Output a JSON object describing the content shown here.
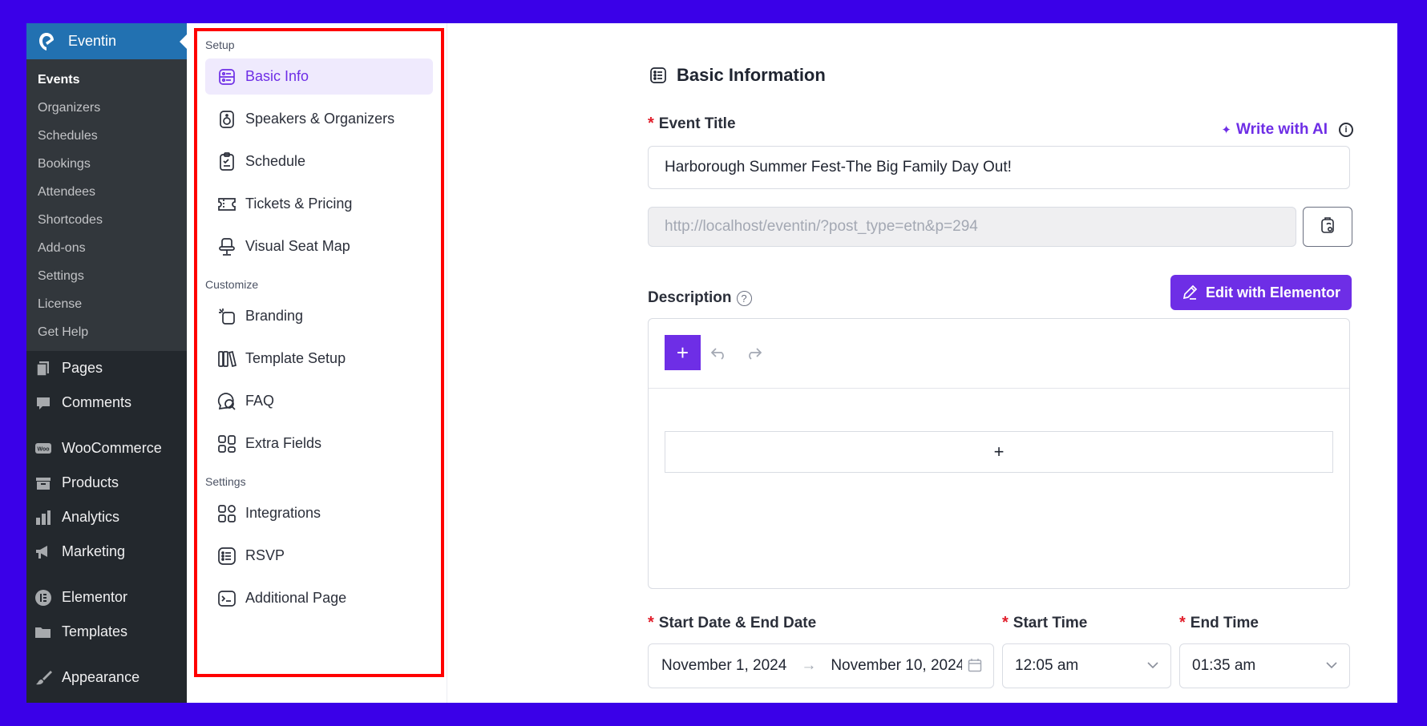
{
  "wp_sidebar": {
    "brand": "Eventin",
    "submenu": [
      "Events",
      "Organizers",
      "Schedules",
      "Bookings",
      "Attendees",
      "Shortcodes",
      "Add-ons",
      "Settings",
      "License",
      "Get Help"
    ],
    "menu": [
      {
        "label": "Pages",
        "icon": "pages-icon"
      },
      {
        "label": "Comments",
        "icon": "comments-icon"
      },
      {
        "label": "WooCommerce",
        "icon": "woocommerce-icon"
      },
      {
        "label": "Products",
        "icon": "products-icon"
      },
      {
        "label": "Analytics",
        "icon": "analytics-icon"
      },
      {
        "label": "Marketing",
        "icon": "marketing-icon"
      },
      {
        "label": "Elementor",
        "icon": "elementor-icon"
      },
      {
        "label": "Templates",
        "icon": "templates-icon"
      },
      {
        "label": "Appearance",
        "icon": "appearance-icon"
      }
    ]
  },
  "event_nav": {
    "sections": [
      {
        "title": "Setup",
        "items": [
          "Basic Info",
          "Speakers & Organizers",
          "Schedule",
          "Tickets & Pricing",
          "Visual Seat Map"
        ]
      },
      {
        "title": "Customize",
        "items": [
          "Branding",
          "Template Setup",
          "FAQ",
          "Extra Fields"
        ]
      },
      {
        "title": "Settings",
        "items": [
          "Integrations",
          "RSVP",
          "Additional Page"
        ]
      }
    ],
    "active": "Basic Info"
  },
  "main": {
    "section_title": "Basic Information",
    "event_title_label": "Event Title",
    "write_ai": "Write with AI",
    "event_title_value": "Harborough Summer Fest-The Big Family Day Out!",
    "permalink": "http://localhost/eventin/?post_type=etn&p=294",
    "description_label": "Description",
    "edit_elementor": "Edit with Elementor",
    "dates_label": "Start Date & End Date",
    "start_time_label": "Start Time",
    "end_time_label": "End Time",
    "start_date": "November 1, 2024",
    "end_date": "November 10, 2024",
    "start_time": "12:05 am",
    "end_time": "01:35 am"
  },
  "colors": {
    "accent": "#6e2ee6",
    "wp_blue": "#2271b1",
    "required": "#e11d2a",
    "frame_bg": "#3a00e8"
  }
}
